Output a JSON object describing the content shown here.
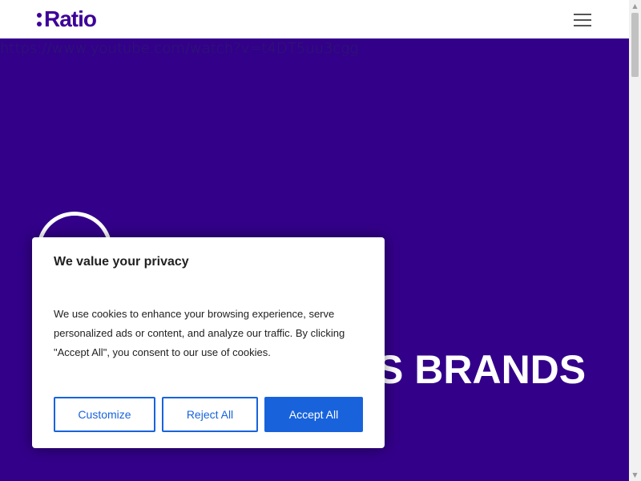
{
  "header": {
    "logo_text": "Ratio",
    "menu_icon": "hamburger-menu-icon"
  },
  "hero": {
    "url_text": "https://www.youtube.com/watch?v=t4DT5uu3cgg",
    "headline_partial": "S BRANDS"
  },
  "cookie_banner": {
    "title": "We value your privacy",
    "body": "We use cookies to enhance your browsing experience, serve personalized ads or content, and analyze our traffic. By clicking \"Accept All\", you consent to our use of cookies.",
    "customize_label": "Customize",
    "reject_label": "Reject All",
    "accept_label": "Accept All"
  },
  "colors": {
    "brand": "#3d0099",
    "hero_bg": "#33008a",
    "button_blue": "#1863dc"
  },
  "scrollbar": {
    "up_icon": "▲",
    "down_icon": "▼"
  }
}
